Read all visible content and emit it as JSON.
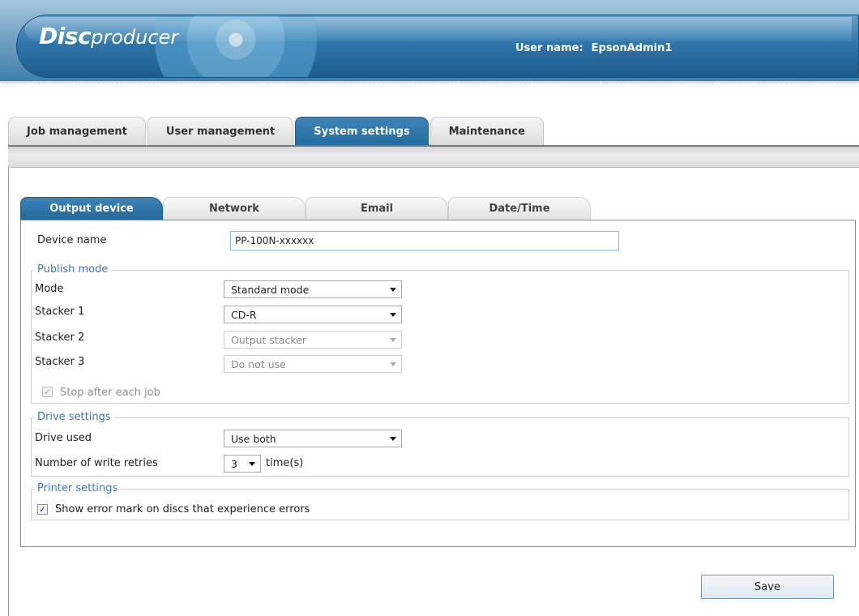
{
  "header": {
    "logo_disc": "Disc",
    "logo_producer": "producer",
    "user_label": "User name:",
    "user_name": "EpsonAdmin1"
  },
  "main_tabs": [
    {
      "label": "Job management",
      "active": false
    },
    {
      "label": "User management",
      "active": false
    },
    {
      "label": "System settings",
      "active": true
    },
    {
      "label": "Maintenance",
      "active": false
    }
  ],
  "sub_tabs": [
    {
      "label": "Output device",
      "active": true
    },
    {
      "label": "Network",
      "active": false
    },
    {
      "label": "Email",
      "active": false
    },
    {
      "label": "Date/Time",
      "active": false
    }
  ],
  "form": {
    "device_name_label": "Device name",
    "device_name_value": "PP-100N-xxxxxx",
    "publish_mode": {
      "title": "Publish mode",
      "mode_label": "Mode",
      "mode_value": "Standard mode",
      "stacker1_label": "Stacker 1",
      "stacker1_value": "CD-R",
      "stacker2_label": "Stacker 2",
      "stacker2_value": "Output stacker",
      "stacker3_label": "Stacker 3",
      "stacker3_value": "Do not use",
      "stop_after_label": "Stop after each job",
      "stop_after_checked": true
    },
    "drive_settings": {
      "title": "Drive settings",
      "drive_used_label": "Drive used",
      "drive_used_value": "Use both",
      "retries_label": "Number of write retries",
      "retries_value": "3",
      "retries_unit": "time(s)"
    },
    "printer_settings": {
      "title": "Printer settings",
      "error_mark_label": "Show error mark on discs that experience errors",
      "error_mark_checked": true
    }
  },
  "save_label": "Save",
  "colors": {
    "accent": "#2f76ac",
    "active_tab": "#2c73a6",
    "group_title": "#3d77b6"
  }
}
